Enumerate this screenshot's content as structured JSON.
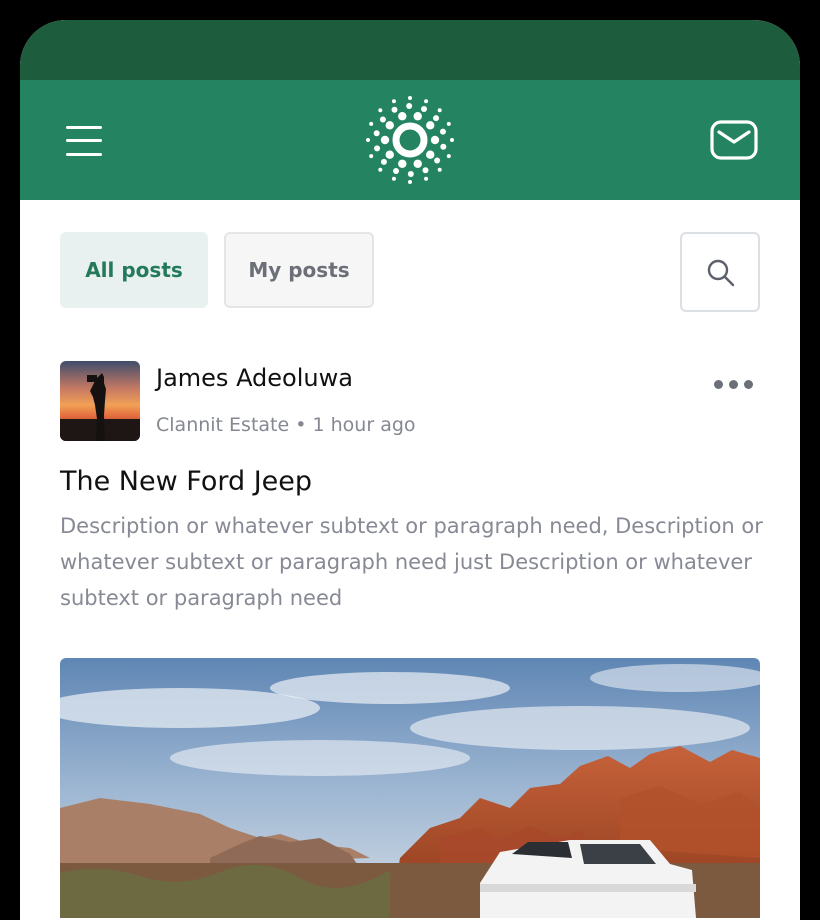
{
  "header": {
    "menu_icon": "hamburger-menu-icon",
    "logo": "dotted-circle-logo",
    "message_icon": "envelope-icon"
  },
  "tabs": [
    {
      "label": "All posts",
      "active": true
    },
    {
      "label": "My posts",
      "active": false
    }
  ],
  "search": {
    "icon": "search-icon"
  },
  "post": {
    "author": "James Adeoluwa",
    "location": "Clannit Estate",
    "separator": "•",
    "time": "1 hour ago",
    "title": "The New Ford Jeep",
    "description": "Description or whatever subtext or paragraph need, Description or whatever subtext or paragraph need just Description or whatever subtext or paragraph need",
    "more_icon": "more-dots-icon"
  },
  "colors": {
    "status_bar": "#1d5c3c",
    "header": "#248462",
    "accent": "#23795a",
    "active_tab_bg": "#e8f1ef"
  }
}
